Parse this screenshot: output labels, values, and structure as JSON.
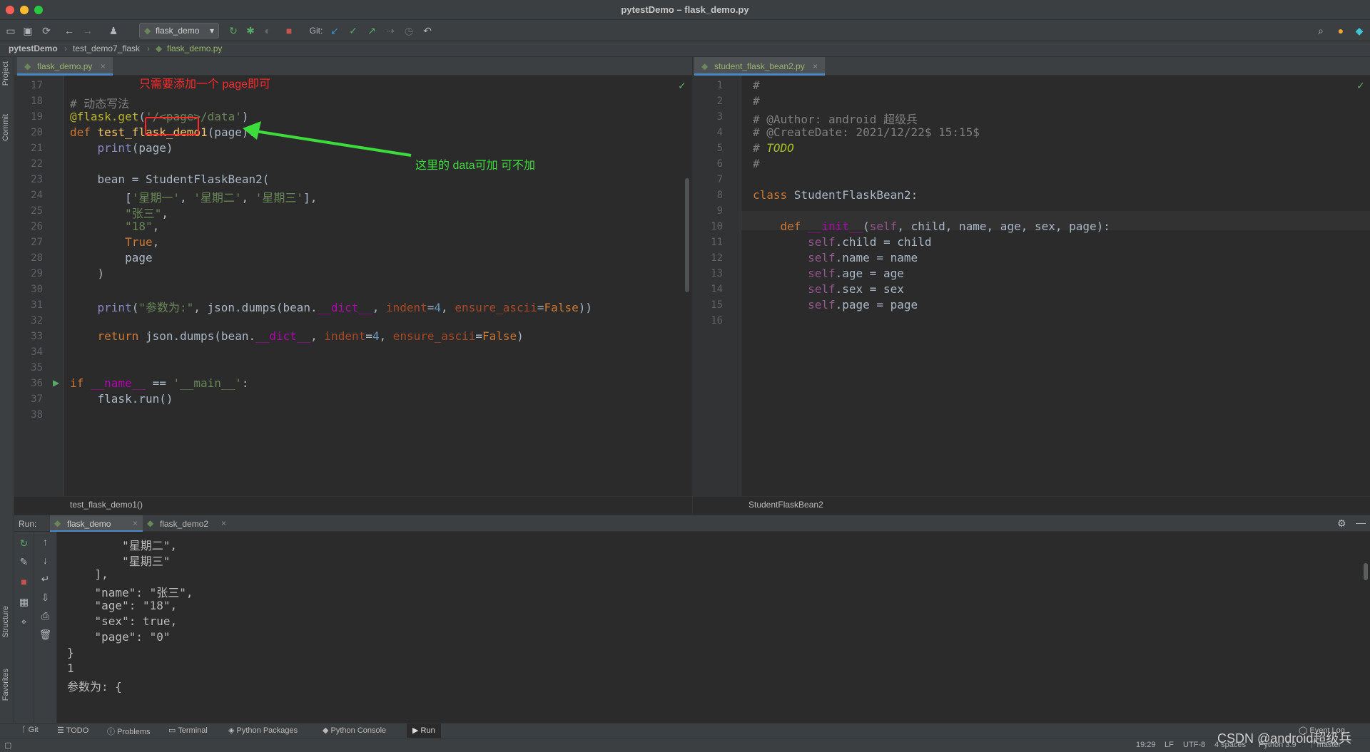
{
  "window": {
    "title": "pytestDemo – flask_demo.py"
  },
  "toolbar": {
    "run_config": "flask_demo",
    "git_label": "Git:"
  },
  "breadcrumb": {
    "project": "pytestDemo",
    "folder": "test_demo7_flask",
    "file": "flask_demo.py"
  },
  "left_strip": {
    "project": "Project",
    "commit": "Commit",
    "structure": "Structure",
    "favorites": "Favorites"
  },
  "left_editor": {
    "tab": "flask_demo.py",
    "line_numbers": [
      "17",
      "18",
      "19",
      "20",
      "21",
      "22",
      "23",
      "24",
      "25",
      "26",
      "27",
      "28",
      "29",
      "30",
      "31",
      "32",
      "33",
      "34",
      "35",
      "36",
      "37",
      "38"
    ],
    "lines": [
      "",
      "# 动态写法",
      "@flask.get('/<page>/data')",
      "def test_flask_demo1(page):",
      "    print(page)",
      "",
      "    bean = StudentFlaskBean2(",
      "        ['星期一', '星期二', '星期三'],",
      "        \"张三\",",
      "        \"18\",",
      "        True,",
      "        page",
      "    )",
      "",
      "    print(\"参数为:\", json.dumps(bean.__dict__, indent=4, ensure_ascii=False))",
      "",
      "    return json.dumps(bean.__dict__, indent=4, ensure_ascii=False)",
      "",
      "",
      "if __name__ == '__main__':",
      "    flask.run()",
      ""
    ],
    "crumb": "test_flask_demo1()",
    "annotation_top": "只需要添加一个 page即可",
    "annotation_arrow": "这里的 data可加 可不加"
  },
  "right_editor": {
    "tab": "student_flask_bean2.py",
    "line_numbers": [
      "1",
      "2",
      "3",
      "4",
      "5",
      "6",
      "7",
      "8",
      "9",
      "10",
      "11",
      "12",
      "13",
      "14",
      "15",
      "16"
    ],
    "lines": [
      "#",
      "#",
      "# @Author: android 超级兵",
      "# @CreateDate: 2021/12/22$ 15:15$",
      "# TODO",
      "#",
      "",
      "class StudentFlaskBean2:",
      "",
      "    def __init__(self, child, name, age, sex, page):",
      "        self.child = child",
      "        self.name = name",
      "        self.age = age",
      "        self.sex = sex",
      "        self.page = page",
      ""
    ],
    "crumb": "StudentFlaskBean2"
  },
  "run_panel": {
    "label": "Run:",
    "tabs": [
      "flask_demo",
      "flask_demo2"
    ],
    "console_lines": [
      "        \"星期二\",",
      "        \"星期三\"",
      "    ],",
      "    \"name\": \"张三\",",
      "    \"age\": \"18\",",
      "    \"sex\": true,",
      "    \"page\": \"0\"",
      "}",
      "1",
      "参数为: {"
    ]
  },
  "bottom_tabs": [
    "Git",
    "TODO",
    "Problems",
    "Terminal",
    "Python Packages",
    "Python Console",
    "Run"
  ],
  "event_log": "Event Log",
  "status": {
    "position": "19:29",
    "line_sep": "LF",
    "encoding": "UTF-8",
    "indent": "4 spaces",
    "interpreter": "Python 3.9",
    "branch": "master"
  },
  "watermark": "CSDN @android超级兵",
  "colors": {
    "accent": "#4a88c7",
    "annotation_red": "#ff2a2a",
    "annotation_green": "#3ddc3d"
  }
}
